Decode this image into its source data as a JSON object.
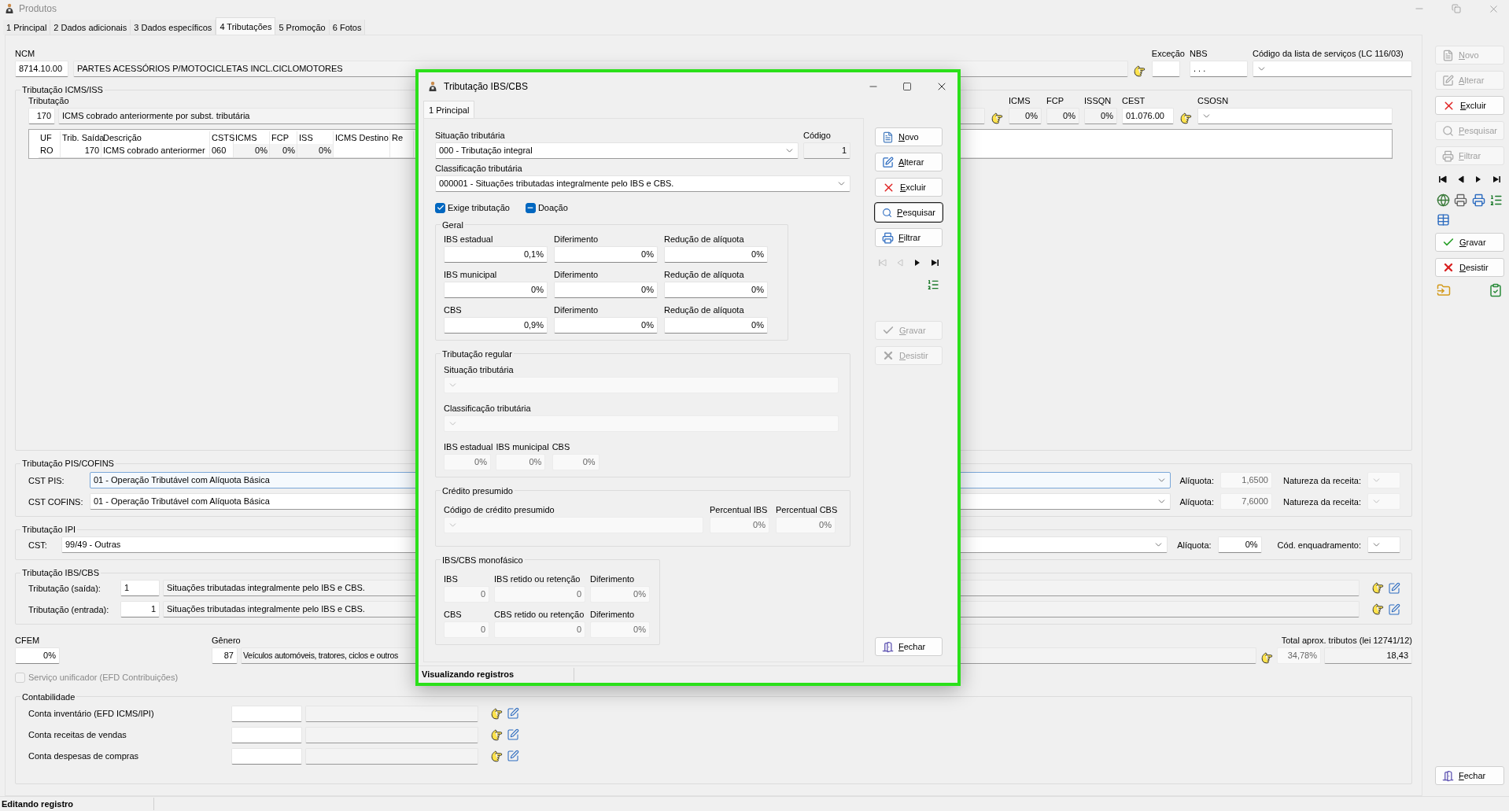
{
  "window": {
    "title": "Produtos"
  },
  "tabs": [
    {
      "label": "1 Principal",
      "selected": false
    },
    {
      "label": "2 Dados adicionais",
      "selected": false
    },
    {
      "label": "3 Dados específicos",
      "selected": false
    },
    {
      "label": "4 Tributações",
      "selected": true
    },
    {
      "label": "5 Promoção",
      "selected": false
    },
    {
      "label": "6 Fotos",
      "selected": false
    }
  ],
  "ncm": {
    "label": "NCM",
    "code": "8714.10.00",
    "description": "PARTES ACESSÓRIOS P/MOTOCICLETAS INCL.CICLOMOTORES"
  },
  "excecao": {
    "label": "Exceção"
  },
  "nbs": {
    "label": "NBS",
    "value": ". . ."
  },
  "codigo_lista": {
    "label": "Código da lista de serviços (LC 116/03)"
  },
  "icms_iss": {
    "title": "Tributação ICMS/ISS",
    "tributacao_label": "Tributação",
    "code": "170",
    "description": "ICMS cobrado anteriormente por subst. tributária",
    "rates": [
      {
        "label": "ICMS",
        "value": "0%"
      },
      {
        "label": "FCP",
        "value": "0%"
      },
      {
        "label": "ISSQN",
        "value": "0%"
      }
    ],
    "cest": {
      "label": "CEST",
      "value": "01.076.00"
    },
    "csosn": {
      "label": "CSOSN"
    },
    "table": {
      "columns": [
        "UF",
        "Trib. Saída",
        "Descrição",
        "CSTS",
        "ICMS",
        "FCP",
        "ISS",
        "ICMS Destino",
        "Re"
      ],
      "rows": [
        [
          "RO",
          "170",
          "ICMS cobrado anteriormer",
          "060",
          "0%",
          "0%",
          "0%"
        ]
      ]
    }
  },
  "pis_cofins": {
    "title": "Tributação PIS/COFINS",
    "rows": [
      {
        "label": "CST PIS:",
        "value": "01 - Operação Tributável com Alíquota Básica",
        "focused": true,
        "aliquota_label": "Alíquota:",
        "aliquota": "1,6500",
        "natureza_label": "Natureza da receita:"
      },
      {
        "label": "CST COFINS:",
        "value": "01 - Operação Tributável com Alíquota Básica",
        "focused": false,
        "aliquota_label": "Alíquota:",
        "aliquota": "7,6000",
        "natureza_label": "Natureza da receita:"
      }
    ]
  },
  "ipi": {
    "title": "Tributação IPI",
    "label": "CST:",
    "value": "99/49 - Outras",
    "aliquota_label": "Alíquota:",
    "aliquota": "0%",
    "enquadramento_label": "Cód. enquadramento:"
  },
  "ibs_cbs": {
    "title": "Tributação IBS/CBS",
    "rows": [
      {
        "label": "Tributação (saída):",
        "code": "1",
        "description": "Situações tributadas integralmente pelo IBS e CBS.",
        "editing": true
      },
      {
        "label": "Tributação (entrada):",
        "code": "1",
        "description": "Situações tributadas integralmente pelo IBS e CBS.",
        "editing": false
      }
    ]
  },
  "cfem": {
    "label": "CFEM",
    "value": "0%"
  },
  "genero": {
    "label": "Gênero",
    "code": "87",
    "description": "Veículos automóveis, tratores, ciclos e outros"
  },
  "total": {
    "label": "Total aprox. tributos (lei 12741/12)",
    "percent": "34,78%",
    "value": "18,43"
  },
  "servico_unificador": {
    "label": "Serviço unificador (EFD Contribuições)",
    "checked": false,
    "disabled": true
  },
  "contabilidade": {
    "title": "Contabilidade",
    "rows": [
      {
        "label": "Conta inventário (EFD ICMS/IPI)"
      },
      {
        "label": "Conta receitas de vendas"
      },
      {
        "label": "Conta despesas de compras"
      }
    ]
  },
  "toolbar": {
    "buttons": [
      {
        "label": "Novo",
        "kind": "new",
        "disabled": true
      },
      {
        "label": "Alterar",
        "kind": "edit",
        "disabled": true
      },
      {
        "label": "Excluir",
        "kind": "delete",
        "disabled": false
      },
      {
        "label": "Pesquisar",
        "kind": "search",
        "disabled": true
      },
      {
        "label": "Filtrar",
        "kind": "filter",
        "disabled": true
      }
    ],
    "nav": [
      {
        "kind": "first",
        "disabled": false
      },
      {
        "kind": "prev",
        "disabled": false
      },
      {
        "kind": "next",
        "disabled": false
      },
      {
        "kind": "last",
        "disabled": false
      }
    ],
    "actions": [
      {
        "label": "Gravar",
        "kind": "save",
        "disabled": false
      },
      {
        "label": "Desistir",
        "kind": "cancel",
        "disabled": false
      }
    ],
    "close": "Fechar"
  },
  "status_bar": "Editando registro",
  "dialog": {
    "title": "Tributação IBS/CBS",
    "tabs": [
      {
        "label": "1 Principal",
        "selected": true
      }
    ],
    "situacao": {
      "label": "Situação tributária",
      "value": "000 - Tributação integral"
    },
    "codigo": {
      "label": "Código",
      "value": "1"
    },
    "classificacao": {
      "label": "Classificação tributária",
      "value": "000001 - Situações tributadas integralmente pelo IBS e CBS."
    },
    "checkboxes": [
      {
        "label": "Exige tributação",
        "checked": true,
        "indeterminate": false
      },
      {
        "label": "Doação",
        "checked": false,
        "indeterminate": true
      }
    ],
    "geral": {
      "title": "Geral",
      "rows": [
        [
          {
            "label": "IBS estadual",
            "value": "0,1%"
          },
          {
            "label": "Diferimento",
            "value": "0%"
          },
          {
            "label": "Redução de alíquota",
            "value": "0%"
          }
        ],
        [
          {
            "label": "IBS municipal",
            "value": "0%"
          },
          {
            "label": "Diferimento",
            "value": "0%"
          },
          {
            "label": "Redução de alíquota",
            "value": "0%"
          }
        ],
        [
          {
            "label": "CBS",
            "value": "0,9%"
          },
          {
            "label": "Diferimento",
            "value": "0%"
          },
          {
            "label": "Redução de alíquota",
            "value": "0%"
          }
        ]
      ]
    },
    "regular": {
      "title": "Tributação regular",
      "situacao_label": "Situação tributária",
      "classificacao_label": "Classificação tributária",
      "rates": [
        {
          "label": "IBS estadual",
          "value": "0%"
        },
        {
          "label": "IBS municipal",
          "value": "0%"
        },
        {
          "label": "CBS",
          "value": "0%"
        }
      ]
    },
    "credito": {
      "title": "Crédito presumido",
      "codigo_label": "Código de crédito presumido",
      "rates": [
        {
          "label": "Percentual IBS",
          "value": "0%"
        },
        {
          "label": "Percentual CBS",
          "value": "0%"
        }
      ]
    },
    "monofasico": {
      "title": "IBS/CBS monofásico",
      "rows": [
        [
          {
            "label": "IBS",
            "value": "0"
          },
          {
            "label": "IBS retido ou retenção",
            "value": "0"
          },
          {
            "label": "Diferimento",
            "value": "0%"
          }
        ],
        [
          {
            "label": "CBS",
            "value": "0"
          },
          {
            "label": "CBS retido ou retenção",
            "value": "0"
          },
          {
            "label": "Diferimento",
            "value": "0%"
          }
        ]
      ]
    },
    "buttons": [
      {
        "label": "Novo",
        "kind": "new",
        "disabled": false,
        "focused": false
      },
      {
        "label": "Alterar",
        "kind": "edit",
        "disabled": false,
        "focused": false
      },
      {
        "label": "Excluir",
        "kind": "delete",
        "disabled": false,
        "focused": false
      },
      {
        "label": "Pesquisar",
        "kind": "search",
        "disabled": false,
        "focused": true
      },
      {
        "label": "Filtrar",
        "kind": "filter",
        "disabled": false,
        "focused": false
      }
    ],
    "nav": [
      {
        "kind": "first",
        "disabled": true
      },
      {
        "kind": "prev",
        "disabled": true
      },
      {
        "kind": "next",
        "disabled": false
      },
      {
        "kind": "last",
        "disabled": false
      }
    ],
    "actions": [
      {
        "label": "Gravar",
        "kind": "save",
        "disabled": true
      },
      {
        "label": "Desistir",
        "kind": "cancel",
        "disabled": true
      }
    ],
    "close": "Fechar",
    "status_bar": "Visualizando registros"
  }
}
